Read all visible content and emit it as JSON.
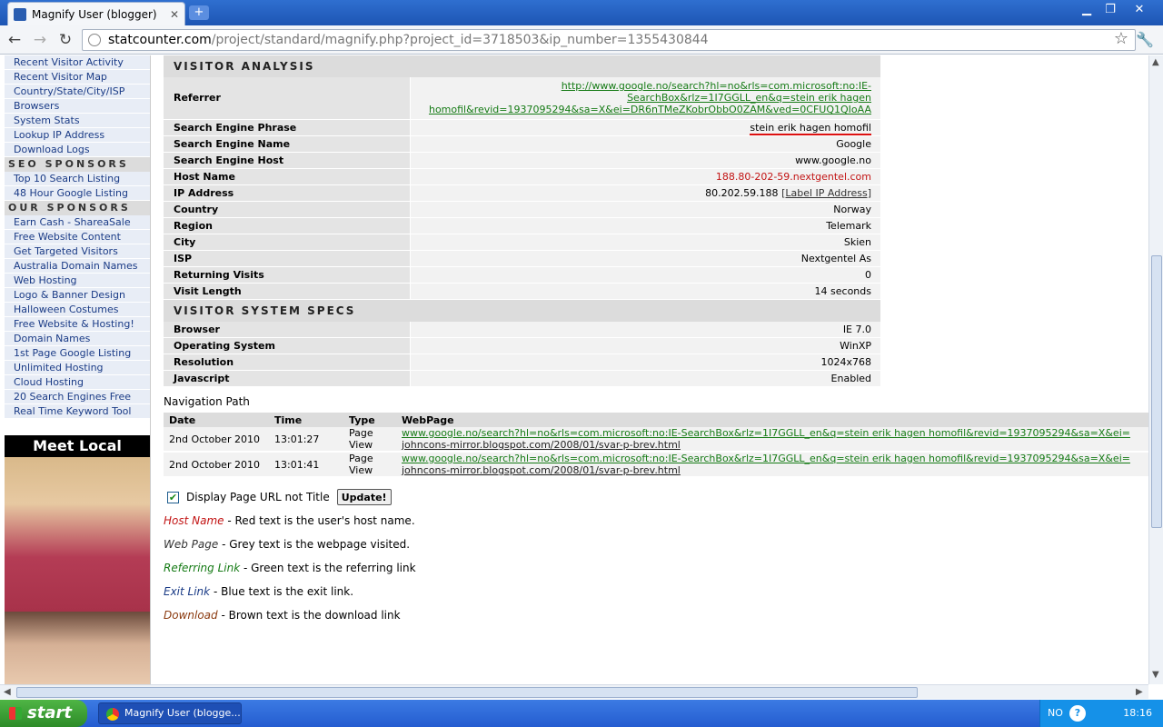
{
  "browser": {
    "tab_title": "Magnify User (blogger)",
    "url_host": "statcounter.com",
    "url_rest": "/project/standard/magnify.php?project_id=3718503&ip_number=1355430844"
  },
  "sidebar": {
    "group1": [
      "Recent Visitor Activity",
      "Recent Visitor Map",
      "Country/State/City/ISP",
      "Browsers",
      "System Stats",
      "Lookup IP Address",
      "Download Logs"
    ],
    "seo_heading": "SEO SPONSORS",
    "seo_links": [
      "Top 10 Search Listing",
      "48 Hour Google Listing"
    ],
    "our_heading": "OUR SPONSORS",
    "our_links": [
      "Earn Cash - ShareaSale",
      "Free Website Content",
      "Get Targeted Visitors",
      "Australia Domain Names",
      "Web Hosting",
      "Logo & Banner Design",
      "Halloween Costumes",
      "Free Website & Hosting!",
      "Domain Names",
      "1st Page Google Listing",
      "Unlimited Hosting",
      "Cloud Hosting",
      "20 Search Engines Free",
      "Real Time Keyword Tool"
    ],
    "ad_title": "Meet Local Singles"
  },
  "analysis": {
    "heading": "VISITOR ANALYSIS",
    "referrer_label": "Referrer",
    "referrer_line1": "http://www.google.no/search?hl=no&rls=com.microsoft:no:IE-",
    "referrer_line2": "SearchBox&rlz=1I7GGLL_en&q=stein erik hagen",
    "referrer_line3": "homofil&revid=1937095294&sa=X&ei=DR6nTMeZKobrObbO0ZAM&ved=0CFUQ1QIoAA",
    "rows": [
      {
        "label": "Search Engine Phrase",
        "value": "stein erik hagen homofil"
      },
      {
        "label": "Search Engine Name",
        "value": "Google"
      },
      {
        "label": "Search Engine Host",
        "value": "www.google.no"
      },
      {
        "label": "Host Name",
        "value": "188.80-202-59.nextgentel.com"
      },
      {
        "label": "IP Address",
        "value": "80.202.59.188",
        "link": "[Label IP Address]"
      },
      {
        "label": "Country",
        "value": "Norway"
      },
      {
        "label": "Region",
        "value": "Telemark"
      },
      {
        "label": "City",
        "value": "Skien"
      },
      {
        "label": "ISP",
        "value": "Nextgentel As"
      },
      {
        "label": "Returning Visits",
        "value": "0"
      },
      {
        "label": "Visit Length",
        "value": "14 seconds"
      }
    ]
  },
  "system": {
    "heading": "VISITOR SYSTEM SPECS",
    "rows": [
      {
        "label": "Browser",
        "value": "IE 7.0"
      },
      {
        "label": "Operating System",
        "value": "WinXP"
      },
      {
        "label": "Resolution",
        "value": "1024x768"
      },
      {
        "label": "Javascript",
        "value": "Enabled"
      }
    ]
  },
  "nav": {
    "title": "Navigation Path",
    "headers": [
      "Date",
      "Time",
      "Type",
      "WebPage"
    ],
    "rows": [
      {
        "date": "2nd October 2010",
        "time": "13:01:27",
        "type": "Page View",
        "ref": "www.google.no/search?hl=no&rls=com.microsoft:no:IE-SearchBox&rlz=1I7GGLL_en&q=stein erik hagen homofil&revid=1937095294&sa=X&ei=",
        "page": "johncons-mirror.blogspot.com/2008/01/svar-p-brev.html"
      },
      {
        "date": "2nd October 2010",
        "time": "13:01:41",
        "type": "Page View",
        "ref": "www.google.no/search?hl=no&rls=com.microsoft:no:IE-SearchBox&rlz=1I7GGLL_en&q=stein erik hagen homofil&revid=1937095294&sa=X&ei=",
        "page": "johncons-mirror.blogspot.com/2008/01/svar-p-brev.html"
      }
    ]
  },
  "controls": {
    "checkbox_label": "Display Page URL not Title",
    "update_label": "Update!"
  },
  "legend": [
    {
      "key": "Host Name",
      "text": " - Red text is the user's host name.",
      "color": "#c21414"
    },
    {
      "key": "Web Page",
      "text": " - Grey text is the webpage visited.",
      "color": "#333333"
    },
    {
      "key": "Referring Link",
      "text": " - Green text is the referring link",
      "color": "#167b16"
    },
    {
      "key": "Exit Link",
      "text": " - Blue text is the exit link.",
      "color": "#1a3b86"
    },
    {
      "key": "Download",
      "text": " - Brown text is the download link",
      "color": "#8b3a0f"
    }
  ],
  "taskbar": {
    "start_label": "start",
    "task_label": "Magnify User (blogge...",
    "lang": "NO",
    "clock": "18:16"
  }
}
